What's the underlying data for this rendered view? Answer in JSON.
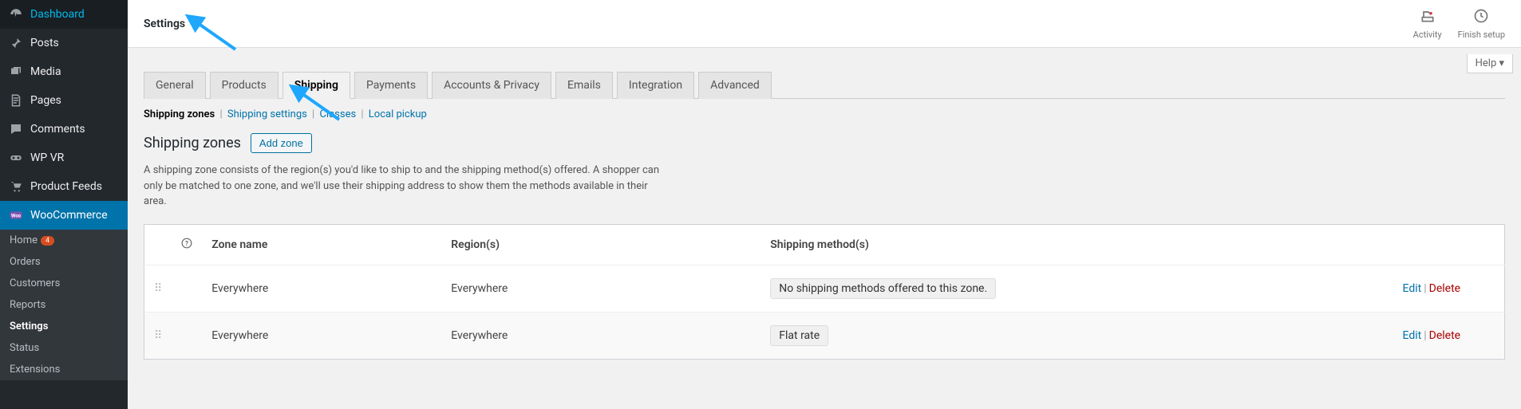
{
  "sidebar": {
    "items": [
      {
        "label": "Dashboard",
        "icon": "dashboard"
      },
      {
        "label": "Posts",
        "icon": "pin"
      },
      {
        "label": "Media",
        "icon": "media"
      },
      {
        "label": "Pages",
        "icon": "pages"
      },
      {
        "label": "Comments",
        "icon": "comments"
      },
      {
        "label": "WP VR",
        "icon": "wpvr"
      },
      {
        "label": "Product Feeds",
        "icon": "cart"
      },
      {
        "label": "WooCommerce",
        "icon": "woo",
        "current": true
      }
    ],
    "subitems": [
      {
        "label": "Home",
        "badge": "4"
      },
      {
        "label": "Orders"
      },
      {
        "label": "Customers"
      },
      {
        "label": "Reports"
      },
      {
        "label": "Settings",
        "selected": true
      },
      {
        "label": "Status"
      },
      {
        "label": "Extensions"
      }
    ]
  },
  "topbar": {
    "title": "Settings",
    "activity": "Activity",
    "finish": "Finish setup",
    "help": "Help ▾"
  },
  "tabs": [
    "General",
    "Products",
    "Shipping",
    "Payments",
    "Accounts & Privacy",
    "Emails",
    "Integration",
    "Advanced"
  ],
  "activeTab": 2,
  "subtabs": [
    "Shipping zones",
    "Shipping settings",
    "Classes",
    "Local pickup"
  ],
  "activeSubtab": 0,
  "heading": "Shipping zones",
  "add_zone": "Add zone",
  "description": "A shipping zone consists of the region(s) you'd like to ship to and the shipping method(s) offered. A shopper can only be matched to one zone, and we'll use their shipping address to show them the methods available in their area.",
  "table": {
    "headers": {
      "help": "?",
      "zone": "Zone name",
      "regions": "Region(s)",
      "methods": "Shipping method(s)"
    },
    "rows": [
      {
        "zone": "Everywhere",
        "regions": "Everywhere",
        "methods": [
          "No shipping methods offered to this zone."
        ]
      },
      {
        "zone": "Everywhere",
        "regions": "Everywhere",
        "methods": [
          "Flat rate"
        ]
      }
    ],
    "edit": "Edit",
    "delete": "Delete"
  }
}
